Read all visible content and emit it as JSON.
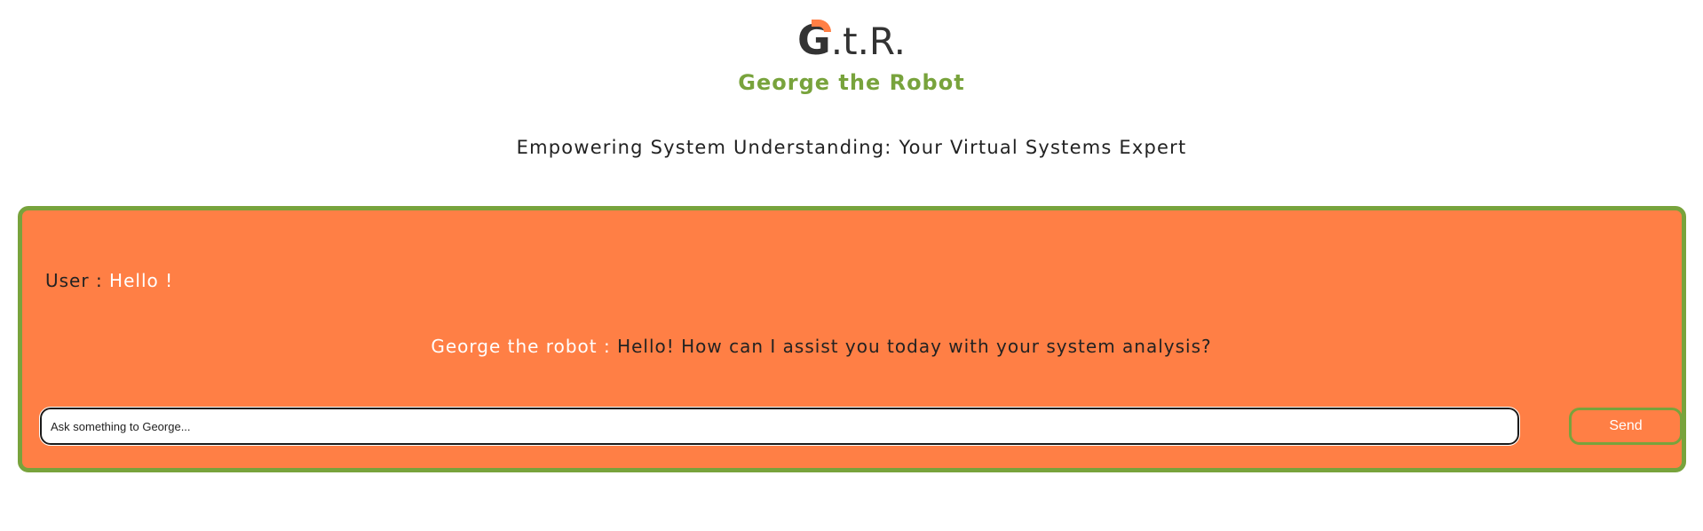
{
  "header": {
    "logo": {
      "g_letter": "G",
      "rest": ".t.R."
    },
    "brand_name": "George the Robot",
    "tagline": "Empowering System Understanding: Your Virtual Systems Expert"
  },
  "chat": {
    "messages": [
      {
        "speaker": "User :",
        "text": "Hello !"
      },
      {
        "speaker": "George the robot :",
        "text": "Hello! How can I assist you today with your system analysis?"
      }
    ],
    "input": {
      "value": "",
      "placeholder": "Ask something to George..."
    },
    "send_label": "Send"
  },
  "colors": {
    "accent_orange": "#ff7f45",
    "accent_green": "#78a33c",
    "text_dark": "#222222",
    "text_light": "#ffffff"
  }
}
